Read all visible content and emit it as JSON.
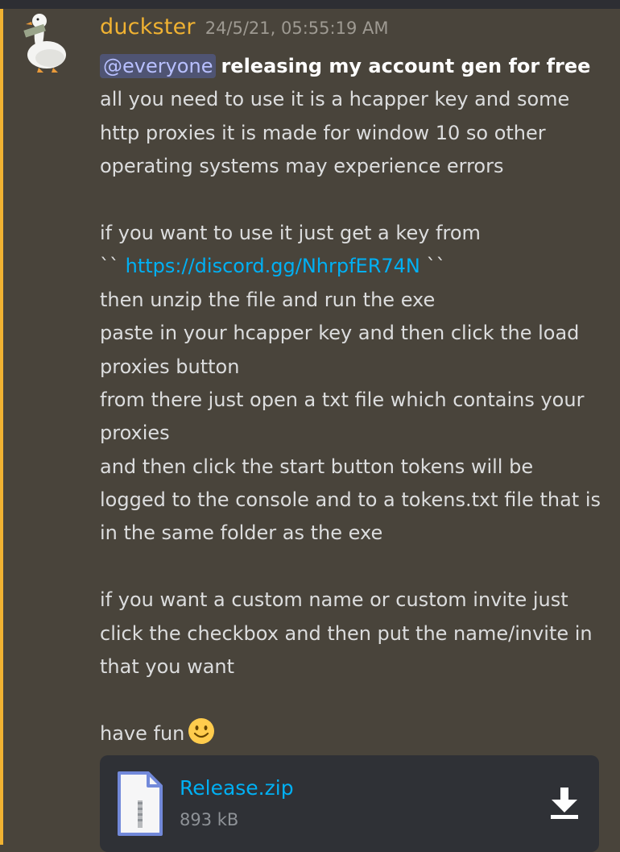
{
  "message": {
    "username": "duckster",
    "timestamp": "24/5/21, 05:55:19 AM",
    "mention": "@everyone",
    "headline": "releasing my account gen for free",
    "lines": [
      "all you need to use it is a hcapper key and some",
      "http proxies it is made for window 10 so other",
      "operating systems may experience errors",
      "",
      "if you want to use it just get a key from",
      "LINK",
      "then unzip the file and run the exe",
      "paste in your hcapper key and then click the load",
      "proxies button",
      "from there just open a txt file which contains your",
      "proxies",
      "and then click the start button tokens will be",
      "logged to the console and to a tokens.txt file that is",
      "in the same folder as the exe",
      "",
      "if you want a custom name or custom invite just",
      "click the checkbox and then put the name/invite in",
      "that you want",
      "",
      "have fun"
    ],
    "code_tick": "``",
    "link": "https://discord.gg/NhrpfER74N",
    "emoji": "slightly-smiling-face"
  },
  "attachment": {
    "file_name": "Release.zip",
    "file_size": "893 kB",
    "icon": "zip-file-icon",
    "download_icon": "download-icon"
  },
  "colors": {
    "background": "#49443b",
    "username": "#f0b232",
    "link": "#00b0f4",
    "text": "#dcddde",
    "mention_bg": "#4f5473",
    "attachment_bg": "#2f3136"
  }
}
